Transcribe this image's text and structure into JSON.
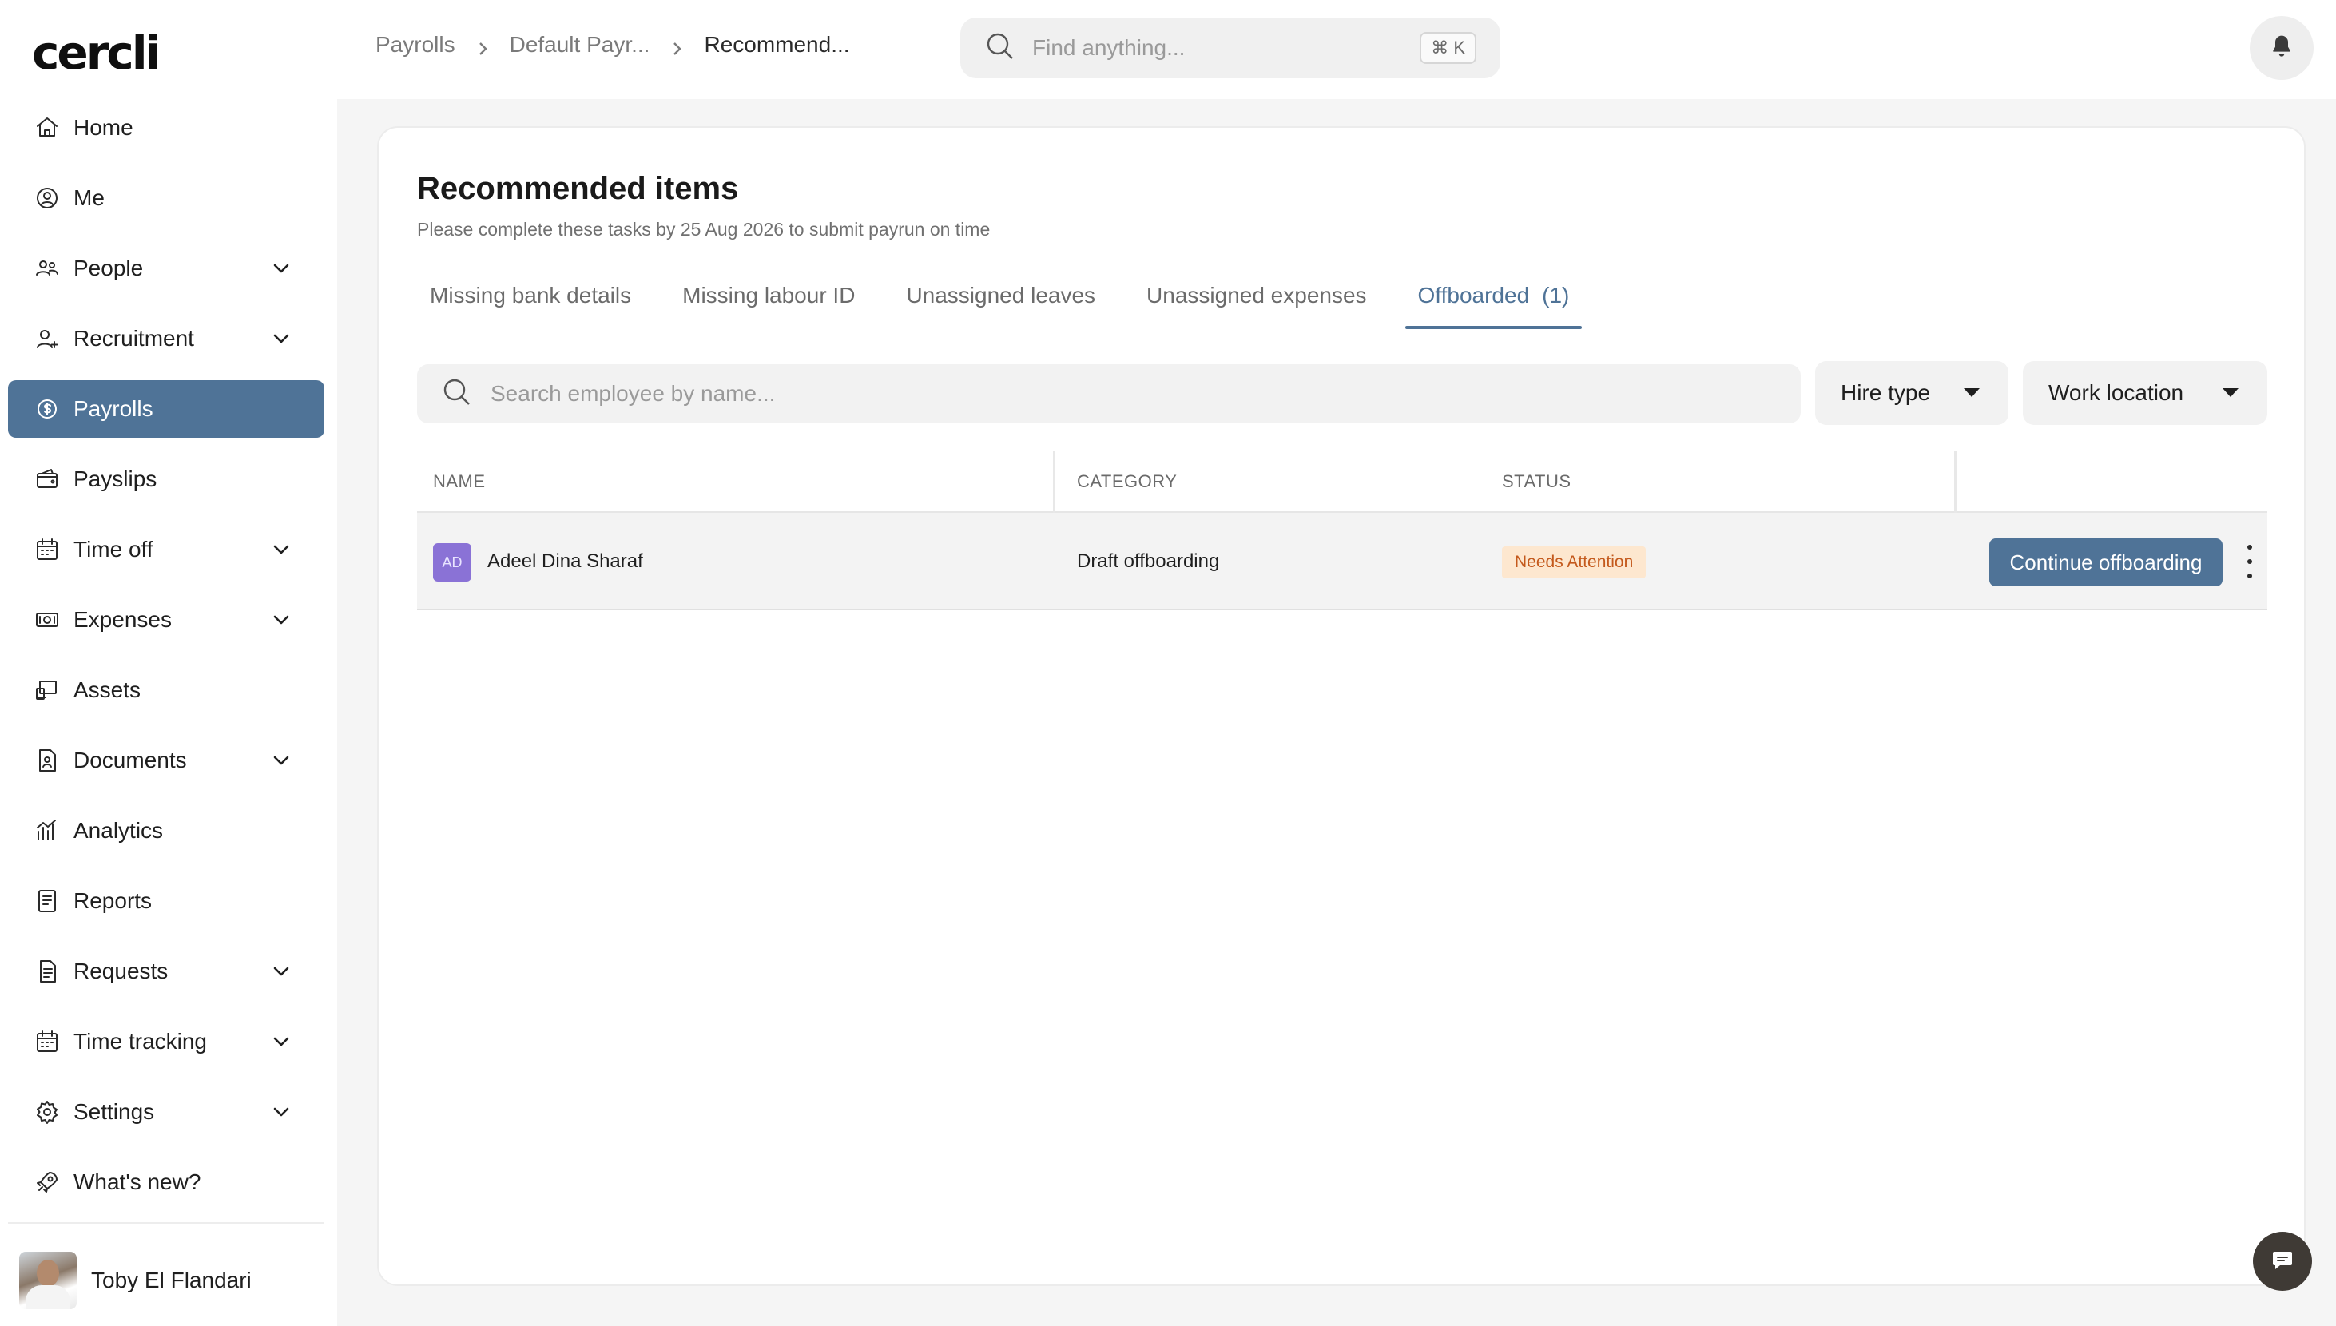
{
  "app": {
    "logo": "cercli"
  },
  "sidebar": {
    "items": [
      {
        "label": "Home",
        "icon": "home-icon",
        "expandable": false,
        "active": false
      },
      {
        "label": "Me",
        "icon": "user-circle-icon",
        "expandable": false,
        "active": false
      },
      {
        "label": "People",
        "icon": "people-icon",
        "expandable": true,
        "active": false
      },
      {
        "label": "Recruitment",
        "icon": "user-plus-icon",
        "expandable": true,
        "active": false
      },
      {
        "label": "Payrolls",
        "icon": "payroll-icon",
        "expandable": false,
        "active": true
      },
      {
        "label": "Payslips",
        "icon": "wallet-icon",
        "expandable": false,
        "active": false
      },
      {
        "label": "Time off",
        "icon": "calendar-icon",
        "expandable": true,
        "active": false
      },
      {
        "label": "Expenses",
        "icon": "money-icon",
        "expandable": true,
        "active": false
      },
      {
        "label": "Assets",
        "icon": "devices-icon",
        "expandable": false,
        "active": false
      },
      {
        "label": "Documents",
        "icon": "document-icon",
        "expandable": true,
        "active": false
      },
      {
        "label": "Analytics",
        "icon": "analytics-icon",
        "expandable": false,
        "active": false
      },
      {
        "label": "Reports",
        "icon": "report-icon",
        "expandable": false,
        "active": false
      },
      {
        "label": "Requests",
        "icon": "request-icon",
        "expandable": true,
        "active": false
      },
      {
        "label": "Time tracking",
        "icon": "calendar-icon",
        "expandable": true,
        "active": false
      },
      {
        "label": "Settings",
        "icon": "gear-icon",
        "expandable": true,
        "active": false
      },
      {
        "label": "What's new?",
        "icon": "rocket-icon",
        "expandable": false,
        "active": false
      }
    ],
    "user": {
      "name": "Toby El Flandari"
    }
  },
  "topbar": {
    "breadcrumb": [
      "Payrolls",
      "Default Payr...",
      "Recommend..."
    ],
    "search_placeholder": "Find anything...",
    "shortcut": "⌘ K"
  },
  "main": {
    "title": "Recommended items",
    "subtitle": "Please complete these tasks by 25 Aug 2026 to submit payrun on time",
    "tabs": [
      {
        "label": "Missing bank details",
        "count": "",
        "active": false
      },
      {
        "label": "Missing labour ID",
        "count": "",
        "active": false
      },
      {
        "label": "Unassigned leaves",
        "count": "",
        "active": false
      },
      {
        "label": "Unassigned expenses",
        "count": "",
        "active": false
      },
      {
        "label": "Offboarded",
        "count": "(1)",
        "active": true
      }
    ],
    "search_placeholder": "Search employee by name...",
    "filters": {
      "hire_type": "Hire type",
      "work_location": "Work location"
    },
    "table": {
      "headers": {
        "name": "NAME",
        "category": "CATEGORY",
        "status": "STATUS"
      },
      "rows": [
        {
          "initials": "AD",
          "name": "Adeel Dina Sharaf",
          "category": "Draft offboarding",
          "status": "Needs Attention",
          "action": "Continue offboarding"
        }
      ]
    }
  },
  "colors": {
    "accent": "#4f7397",
    "status_bg": "#fde7cf",
    "status_text": "#c4591c",
    "avatar_badge": "#8a72d6"
  }
}
